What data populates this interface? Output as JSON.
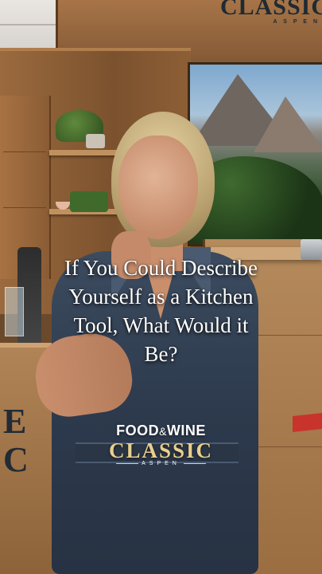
{
  "caption": {
    "line1": "If You Could Describe",
    "line2": "Yourself as a Kitchen",
    "line3": "Tool, What Would it",
    "line4": "Be?"
  },
  "logo": {
    "food": "FOOD",
    "amp": "&",
    "wine": "WINE",
    "classic": "CLASSIC",
    "aspen": "ASPEN"
  },
  "background_sign": {
    "classic": "CLASSIC",
    "aspen": "A S P E N"
  },
  "island_letters": "E\nC",
  "colors": {
    "caption_text": "#ffffff",
    "logo_gold": "#e9cf8e",
    "wood": "#9b6e42",
    "denim": "#2d3a4d"
  }
}
